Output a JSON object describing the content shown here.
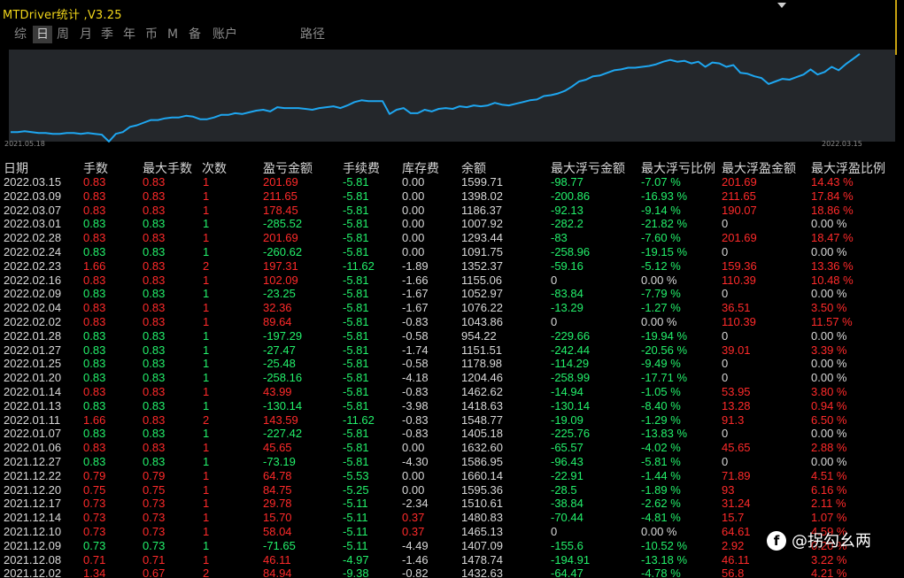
{
  "window": {
    "title": "MTDriver统计 ,V3.25"
  },
  "tabs": [
    {
      "label": "综",
      "active": false
    },
    {
      "label": "日",
      "active": true
    },
    {
      "label": "周",
      "active": false
    },
    {
      "label": "月",
      "active": false
    },
    {
      "label": "季",
      "active": false
    },
    {
      "label": "年",
      "active": false
    },
    {
      "label": "币",
      "active": false
    },
    {
      "label": "M",
      "active": false
    },
    {
      "label": "备",
      "active": false
    },
    {
      "label": "账户",
      "active": false
    },
    {
      "label": "路径",
      "active": false
    }
  ],
  "chart_data": {
    "type": "line",
    "title": "",
    "xlabel": "",
    "ylabel": "",
    "x_start": "2021.05.18",
    "x_end": "2022.03.15",
    "color": "#1ea6f0",
    "values": [
      0.07,
      0.07,
      0.08,
      0.07,
      0.06,
      0.06,
      0.05,
      0.05,
      0.06,
      0.06,
      0.05,
      0.06,
      0.05,
      0.04,
      -0.04,
      0.05,
      0.07,
      0.13,
      0.15,
      0.18,
      0.21,
      0.21,
      0.23,
      0.24,
      0.24,
      0.26,
      0.25,
      0.22,
      0.22,
      0.24,
      0.27,
      0.27,
      0.29,
      0.28,
      0.3,
      0.32,
      0.33,
      0.31,
      0.36,
      0.35,
      0.35,
      0.35,
      0.34,
      0.33,
      0.35,
      0.36,
      0.37,
      0.35,
      0.38,
      0.42,
      0.44,
      0.43,
      0.43,
      0.43,
      0.28,
      0.33,
      0.35,
      0.29,
      0.29,
      0.33,
      0.31,
      0.34,
      0.35,
      0.34,
      0.37,
      0.36,
      0.38,
      0.37,
      0.38,
      0.41,
      0.39,
      0.38,
      0.4,
      0.42,
      0.44,
      0.45,
      0.49,
      0.5,
      0.52,
      0.55,
      0.6,
      0.66,
      0.68,
      0.72,
      0.73,
      0.76,
      0.79,
      0.8,
      0.82,
      0.82,
      0.83,
      0.84,
      0.86,
      0.89,
      0.91,
      0.89,
      0.9,
      0.87,
      0.89,
      0.83,
      0.88,
      0.87,
      0.83,
      0.85,
      0.76,
      0.75,
      0.72,
      0.7,
      0.63,
      0.66,
      0.69,
      0.68,
      0.71,
      0.74,
      0.8,
      0.74,
      0.77,
      0.83,
      0.79,
      0.86,
      0.92,
      0.98
    ]
  },
  "table": {
    "columns": [
      "日期",
      "手数",
      "最大手数",
      "次数",
      "盈亏金额",
      "手续费",
      "库存费",
      "余额",
      "最大浮亏金额",
      "最大浮亏比例",
      "最大浮盈金额",
      "最大浮盈比例"
    ],
    "rows": [
      [
        "2022.03.15",
        "0.83",
        "0.83",
        "1",
        "201.69",
        "-5.81",
        "0.00",
        "1599.71",
        "-98.77",
        "-7.07 %",
        "201.69",
        "14.43 %"
      ],
      [
        "2022.03.09",
        "0.83",
        "0.83",
        "1",
        "211.65",
        "-5.81",
        "0.00",
        "1398.02",
        "-200.86",
        "-16.93 %",
        "211.65",
        "17.84 %"
      ],
      [
        "2022.03.07",
        "0.83",
        "0.83",
        "1",
        "178.45",
        "-5.81",
        "0.00",
        "1186.37",
        "-92.13",
        "-9.14 %",
        "190.07",
        "18.86 %"
      ],
      [
        "2022.03.01",
        "0.83",
        "0.83",
        "1",
        "-285.52",
        "-5.81",
        "0.00",
        "1007.92",
        "-282.2",
        "-21.82 %",
        "0",
        "0.00 %"
      ],
      [
        "2022.02.28",
        "0.83",
        "0.83",
        "1",
        "201.69",
        "-5.81",
        "0.00",
        "1293.44",
        "-83",
        "-7.60 %",
        "201.69",
        "18.47 %"
      ],
      [
        "2022.02.24",
        "0.83",
        "0.83",
        "1",
        "-260.62",
        "-5.81",
        "0.00",
        "1091.75",
        "-258.96",
        "-19.15 %",
        "0",
        "0.00 %"
      ],
      [
        "2022.02.23",
        "1.66",
        "0.83",
        "2",
        "197.31",
        "-11.62",
        "-1.89",
        "1352.37",
        "-59.16",
        "-5.12 %",
        "159.36",
        "13.36 %"
      ],
      [
        "2022.02.16",
        "0.83",
        "0.83",
        "1",
        "102.09",
        "-5.81",
        "-1.66",
        "1155.06",
        "0",
        "0.00 %",
        "110.39",
        "10.48 %"
      ],
      [
        "2022.02.09",
        "0.83",
        "0.83",
        "1",
        "-23.25",
        "-5.81",
        "-1.67",
        "1052.97",
        "-83.84",
        "-7.79 %",
        "0",
        "0.00 %"
      ],
      [
        "2022.02.04",
        "0.83",
        "0.83",
        "1",
        "32.36",
        "-5.81",
        "-1.67",
        "1076.22",
        "-13.29",
        "-1.27 %",
        "36.51",
        "3.50 %"
      ],
      [
        "2022.02.02",
        "0.83",
        "0.83",
        "1",
        "89.64",
        "-5.81",
        "-0.83",
        "1043.86",
        "0",
        "0.00 %",
        "110.39",
        "11.57 %"
      ],
      [
        "2022.01.28",
        "0.83",
        "0.83",
        "1",
        "-197.29",
        "-5.81",
        "-0.58",
        "954.22",
        "-229.66",
        "-19.94 %",
        "0",
        "0.00 %"
      ],
      [
        "2022.01.27",
        "0.83",
        "0.83",
        "1",
        "-27.47",
        "-5.81",
        "-1.74",
        "1151.51",
        "-242.44",
        "-20.56 %",
        "39.01",
        "3.39 %"
      ],
      [
        "2022.01.25",
        "0.83",
        "0.83",
        "1",
        "-25.48",
        "-5.81",
        "-0.58",
        "1178.98",
        "-114.29",
        "-9.49 %",
        "0",
        "0.00 %"
      ],
      [
        "2022.01.20",
        "0.83",
        "0.83",
        "1",
        "-258.16",
        "-5.81",
        "-4.18",
        "1204.46",
        "-258.99",
        "-17.71 %",
        "0",
        "0.00 %"
      ],
      [
        "2022.01.14",
        "0.83",
        "0.83",
        "1",
        "43.99",
        "-5.81",
        "-0.83",
        "1462.62",
        "-14.94",
        "-1.05 %",
        "53.95",
        "3.80 %"
      ],
      [
        "2022.01.13",
        "0.83",
        "0.83",
        "1",
        "-130.14",
        "-5.81",
        "-3.98",
        "1418.63",
        "-130.14",
        "-8.40 %",
        "13.28",
        "0.94 %"
      ],
      [
        "2022.01.11",
        "1.66",
        "0.83",
        "2",
        "143.59",
        "-11.62",
        "-0.83",
        "1548.77",
        "-19.09",
        "-1.29 %",
        "91.3",
        "6.50 %"
      ],
      [
        "2022.01.07",
        "0.83",
        "0.83",
        "1",
        "-227.42",
        "-5.81",
        "-0.83",
        "1405.18",
        "-225.76",
        "-13.83 %",
        "0",
        "0.00 %"
      ],
      [
        "2022.01.06",
        "0.83",
        "0.83",
        "1",
        "45.65",
        "-5.81",
        "0.00",
        "1632.60",
        "-65.57",
        "-4.02 %",
        "45.65",
        "2.88 %"
      ],
      [
        "2021.12.27",
        "0.83",
        "0.83",
        "1",
        "-73.19",
        "-5.81",
        "-4.30",
        "1586.95",
        "-96.43",
        "-5.81 %",
        "0",
        "0.00 %"
      ],
      [
        "2021.12.22",
        "0.79",
        "0.79",
        "1",
        "64.78",
        "-5.53",
        "0.00",
        "1660.14",
        "-22.91",
        "-1.44 %",
        "71.89",
        "4.51 %"
      ],
      [
        "2021.12.20",
        "0.75",
        "0.75",
        "1",
        "84.75",
        "-5.25",
        "0.00",
        "1595.36",
        "-28.5",
        "-1.89 %",
        "93",
        "6.16 %"
      ],
      [
        "2021.12.17",
        "0.73",
        "0.73",
        "1",
        "29.78",
        "-5.11",
        "-2.34",
        "1510.61",
        "-38.84",
        "-2.62 %",
        "31.24",
        "2.11 %"
      ],
      [
        "2021.12.14",
        "0.73",
        "0.73",
        "1",
        "15.70",
        "-5.11",
        "0.37",
        "1480.83",
        "-70.44",
        "-4.81 %",
        "15.7",
        "1.07 %"
      ],
      [
        "2021.12.10",
        "0.73",
        "0.73",
        "1",
        "58.04",
        "-5.11",
        "0.37",
        "1465.13",
        "0",
        "0.00 %",
        "64.61",
        "4.59 %"
      ],
      [
        "2021.12.09",
        "0.73",
        "0.73",
        "1",
        "-71.65",
        "-5.11",
        "-4.49",
        "1407.09",
        "-155.6",
        "-10.52 %",
        "2.92",
        "0.20 %"
      ],
      [
        "2021.12.08",
        "0.71",
        "0.71",
        "1",
        "46.11",
        "-4.97",
        "-1.46",
        "1478.74",
        "-194.91",
        "-13.18 %",
        "46.11",
        "3.22 %"
      ],
      [
        "2021.12.02",
        "1.34",
        "0.67",
        "2",
        "84.94",
        "-9.38",
        "-0.82",
        "1432.63",
        "-64.47",
        "-4.78 %",
        "56.8",
        "4.21 %"
      ]
    ]
  },
  "watermark": {
    "icon": "circle-f-icon",
    "icon_glyph": "f",
    "text": "@拐勾幺两"
  }
}
